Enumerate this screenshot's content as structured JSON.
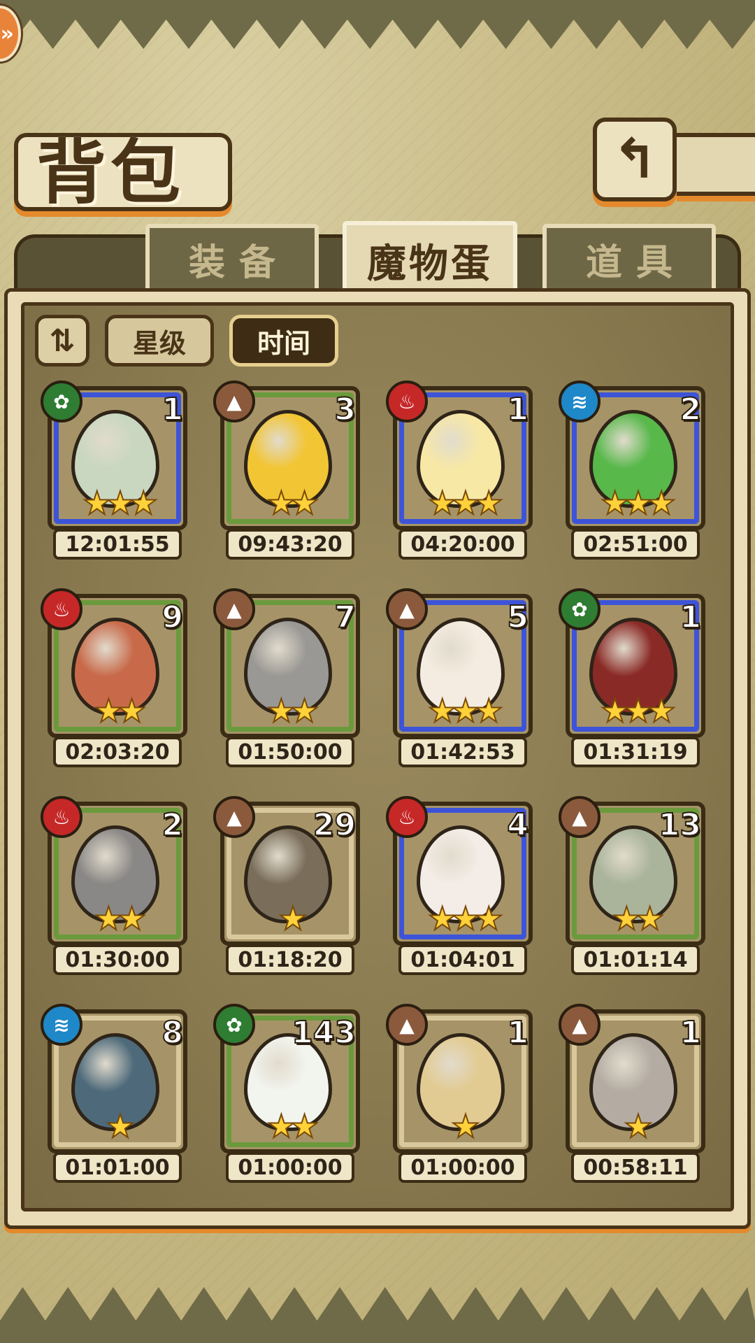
{
  "header": {
    "title": "背包",
    "back_icon": "↰",
    "corner_icon": "»"
  },
  "tabs": [
    {
      "label": "装备",
      "active": false
    },
    {
      "label": "魔物蛋",
      "active": true
    },
    {
      "label": "道具",
      "active": false
    }
  ],
  "sort": {
    "toggle_icon": "⇅",
    "star_label": "星级",
    "time_label": "时间"
  },
  "colors": {
    "blue_rarity": "#3d54d8",
    "green_rarity": "#6a9a3c",
    "tan_rarity": "#d8c89c",
    "fire": "#c62828",
    "earth": "#8b5a3c",
    "wood": "#2e7d32",
    "water": "#1e88c8"
  },
  "eggs": [
    {
      "element": "wood",
      "element_icon": "✿",
      "count": "1",
      "stars": "★★★",
      "time": "12:01:55",
      "rarity": "blue",
      "egg_color": "#c9d7c0"
    },
    {
      "element": "earth",
      "element_icon": "▲",
      "count": "3",
      "stars": "★★",
      "time": "09:43:20",
      "rarity": "green",
      "egg_color": "#f2c534"
    },
    {
      "element": "fire",
      "element_icon": "♨",
      "count": "1",
      "stars": "★★★",
      "time": "04:20:00",
      "rarity": "blue",
      "egg_color": "#f7e8a6"
    },
    {
      "element": "water",
      "element_icon": "≋",
      "count": "2",
      "stars": "★★★",
      "time": "02:51:00",
      "rarity": "blue",
      "egg_color": "#58b84a"
    },
    {
      "element": "fire",
      "element_icon": "♨",
      "count": "9",
      "stars": "★★",
      "time": "02:03:20",
      "rarity": "green",
      "egg_color": "#c86a4a"
    },
    {
      "element": "earth",
      "element_icon": "▲",
      "count": "7",
      "stars": "★★",
      "time": "01:50:00",
      "rarity": "green",
      "egg_color": "#9a9894"
    },
    {
      "element": "earth",
      "element_icon": "▲",
      "count": "5",
      "stars": "★★★",
      "time": "01:42:53",
      "rarity": "blue",
      "egg_color": "#f4ece0"
    },
    {
      "element": "wood",
      "element_icon": "✿",
      "count": "1",
      "stars": "★★★",
      "time": "01:31:19",
      "rarity": "blue",
      "egg_color": "#8a2a26"
    },
    {
      "element": "fire",
      "element_icon": "♨",
      "count": "2",
      "stars": "★★",
      "time": "01:30:00",
      "rarity": "green",
      "egg_color": "#8a8886"
    },
    {
      "element": "earth",
      "element_icon": "▲",
      "count": "29",
      "stars": "★",
      "time": "01:18:20",
      "rarity": "tan",
      "egg_color": "#7a6e5a"
    },
    {
      "element": "fire",
      "element_icon": "♨",
      "count": "4",
      "stars": "★★★",
      "time": "01:04:01",
      "rarity": "blue",
      "egg_color": "#f4ece6"
    },
    {
      "element": "earth",
      "element_icon": "▲",
      "count": "13",
      "stars": "★★",
      "time": "01:01:14",
      "rarity": "green",
      "egg_color": "#aab49a"
    },
    {
      "element": "water",
      "element_icon": "≋",
      "count": "8",
      "stars": "★",
      "time": "01:01:00",
      "rarity": "tan",
      "egg_color": "#4e6a7a"
    },
    {
      "element": "wood",
      "element_icon": "✿",
      "count": "143",
      "stars": "★★",
      "time": "01:00:00",
      "rarity": "green",
      "egg_color": "#f2f4ee"
    },
    {
      "element": "earth",
      "element_icon": "▲",
      "count": "1",
      "stars": "★",
      "time": "01:00:00",
      "rarity": "tan",
      "egg_color": "#e2cb92"
    },
    {
      "element": "earth",
      "element_icon": "▲",
      "count": "1",
      "stars": "★",
      "time": "00:58:11",
      "rarity": "tan",
      "egg_color": "#b4aca2"
    }
  ]
}
